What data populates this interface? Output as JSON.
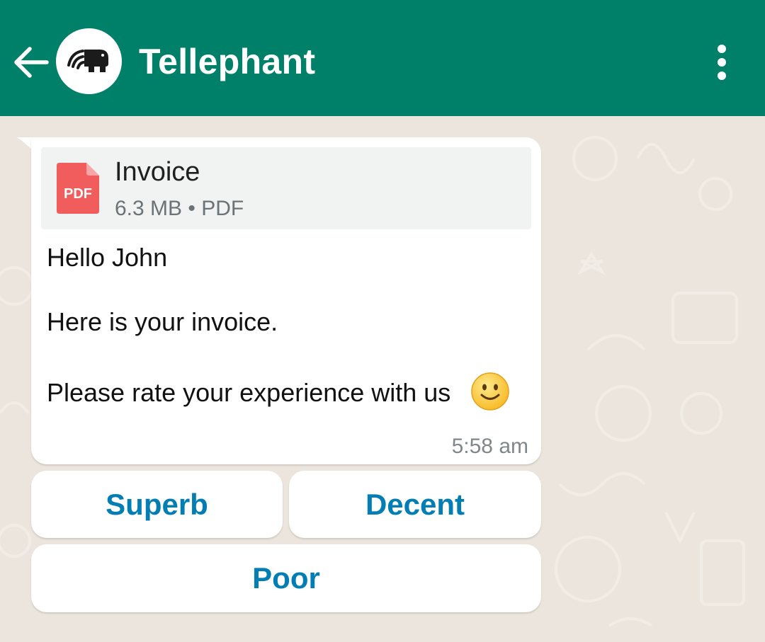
{
  "header": {
    "title": "Tellephant",
    "back_icon": "arrow-left-icon",
    "menu_icon": "more-vertical-icon",
    "color": "#008069"
  },
  "message": {
    "attachment": {
      "icon": "pdf-file-icon",
      "icon_label": "PDF",
      "name": "Invoice",
      "meta": "6.3 MB • PDF"
    },
    "lines": [
      "Hello John",
      "Here is your invoice.",
      "Please rate your experience with us"
    ],
    "emoji": "slightly-smiling-face-icon",
    "time": "5:58 am"
  },
  "quick_replies": [
    "Superb",
    "Decent",
    "Poor"
  ],
  "colors": {
    "background": "#ece5dd",
    "button_text": "#027eb5",
    "pdf_red": "#f15c5c"
  }
}
